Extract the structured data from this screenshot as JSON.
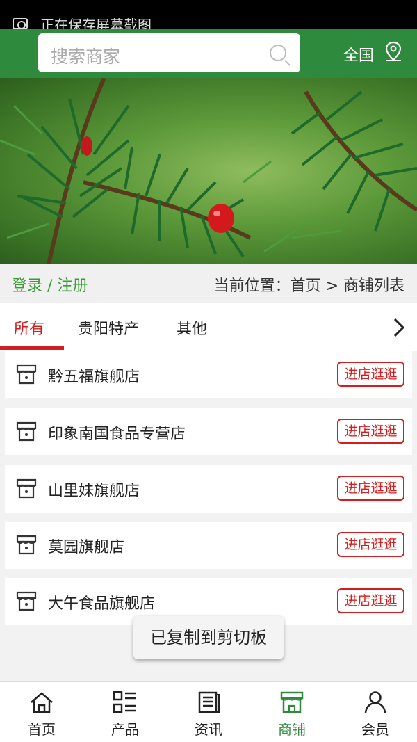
{
  "status_bar": {
    "notification": "正在保存屏幕截图"
  },
  "header": {
    "search_placeholder": "搜索商家",
    "region": "全国"
  },
  "location_bar": {
    "login": "登录 / 注册",
    "breadcrumb": "当前位置：首页 > 商铺列表"
  },
  "tabs": [
    {
      "label": "所有",
      "active": true
    },
    {
      "label": "贵阳特产",
      "active": false
    },
    {
      "label": "其他",
      "active": false
    }
  ],
  "stores": [
    {
      "name": "黔五福旗舰店",
      "action": "进店逛逛"
    },
    {
      "name": "印象南国食品专营店",
      "action": "进店逛逛"
    },
    {
      "name": "山里妹旗舰店",
      "action": "进店逛逛"
    },
    {
      "name": "莫园旗舰店",
      "action": "进店逛逛"
    },
    {
      "name": "大午食品旗舰店",
      "action": "进店逛逛"
    }
  ],
  "toast": "已复制到剪切板",
  "bottom_nav": [
    {
      "label": "首页",
      "icon": "home-icon",
      "active": false
    },
    {
      "label": "产品",
      "icon": "product-grid-icon",
      "active": false
    },
    {
      "label": "资讯",
      "icon": "news-icon",
      "active": false
    },
    {
      "label": "商铺",
      "icon": "store-icon",
      "active": true
    },
    {
      "label": "会员",
      "icon": "member-icon",
      "active": false
    }
  ],
  "colors": {
    "brand_green": "#2e8b3e",
    "accent_red": "#d21e1e",
    "login_green": "#3a9d33"
  }
}
